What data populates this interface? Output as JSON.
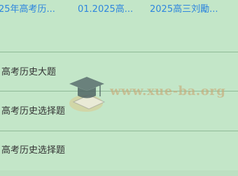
{
  "tabs": [
    {
      "label": "25年高考历..."
    },
    {
      "label": "01.2025高..."
    },
    {
      "label": "2025高三刘勵..."
    }
  ],
  "items": [
    {
      "label": "高考历史大题"
    },
    {
      "label": "高考历史选择题"
    },
    {
      "label": "高考历史选择题"
    }
  ],
  "watermark": {
    "text": "www.xue-ba.org"
  }
}
